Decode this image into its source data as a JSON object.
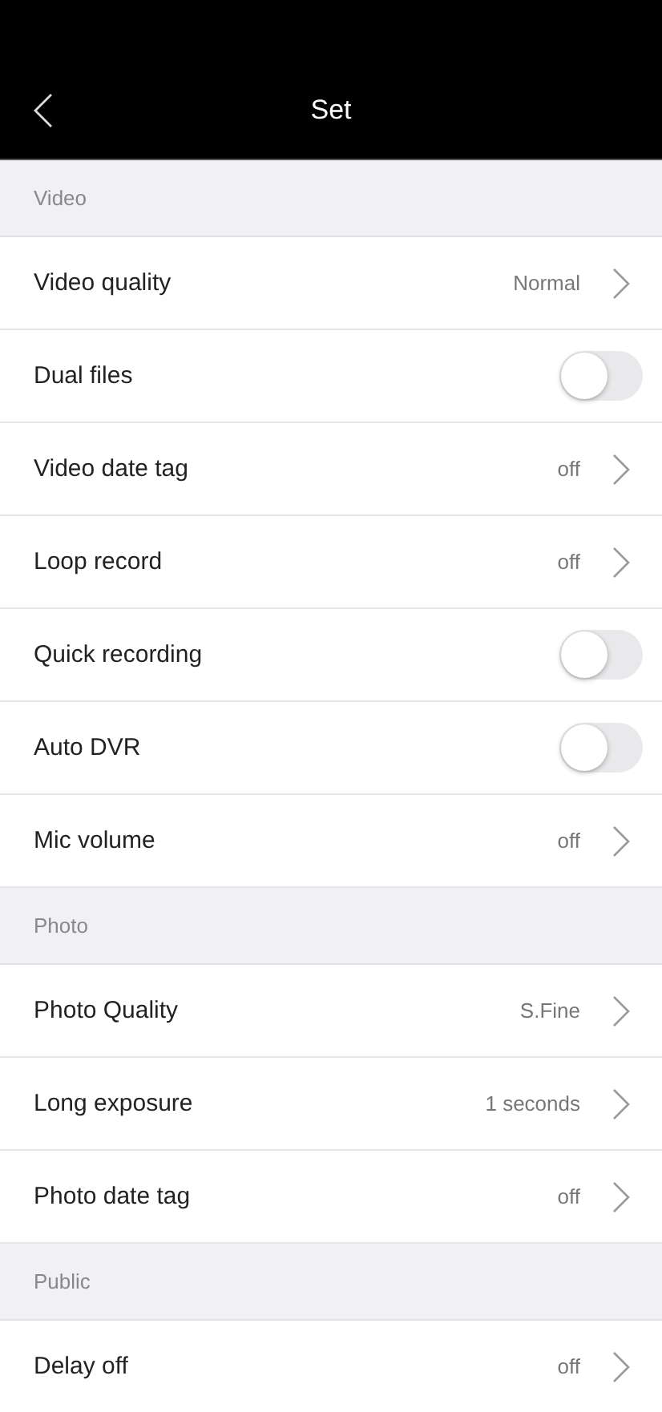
{
  "header": {
    "title": "Set"
  },
  "sections": [
    {
      "title": "Video",
      "rows": [
        {
          "kind": "value",
          "label": "Video quality",
          "value": "Normal"
        },
        {
          "kind": "switch",
          "label": "Dual files",
          "on": false
        },
        {
          "kind": "value",
          "label": "Video date tag",
          "value": "off"
        },
        {
          "kind": "value",
          "label": "Loop record",
          "value": "off"
        },
        {
          "kind": "switch",
          "label": "Quick recording",
          "on": false
        },
        {
          "kind": "switch",
          "label": "Auto DVR",
          "on": false
        },
        {
          "kind": "value",
          "label": "Mic volume",
          "value": "off"
        }
      ]
    },
    {
      "title": "Photo",
      "rows": [
        {
          "kind": "value",
          "label": "Photo Quality",
          "value": "S.Fine"
        },
        {
          "kind": "value",
          "label": "Long exposure",
          "value": "1 seconds"
        },
        {
          "kind": "value",
          "label": "Photo date tag",
          "value": "off"
        }
      ]
    },
    {
      "title": "Public",
      "rows": [
        {
          "kind": "value",
          "label": "Delay off",
          "value": "off"
        }
      ]
    }
  ]
}
